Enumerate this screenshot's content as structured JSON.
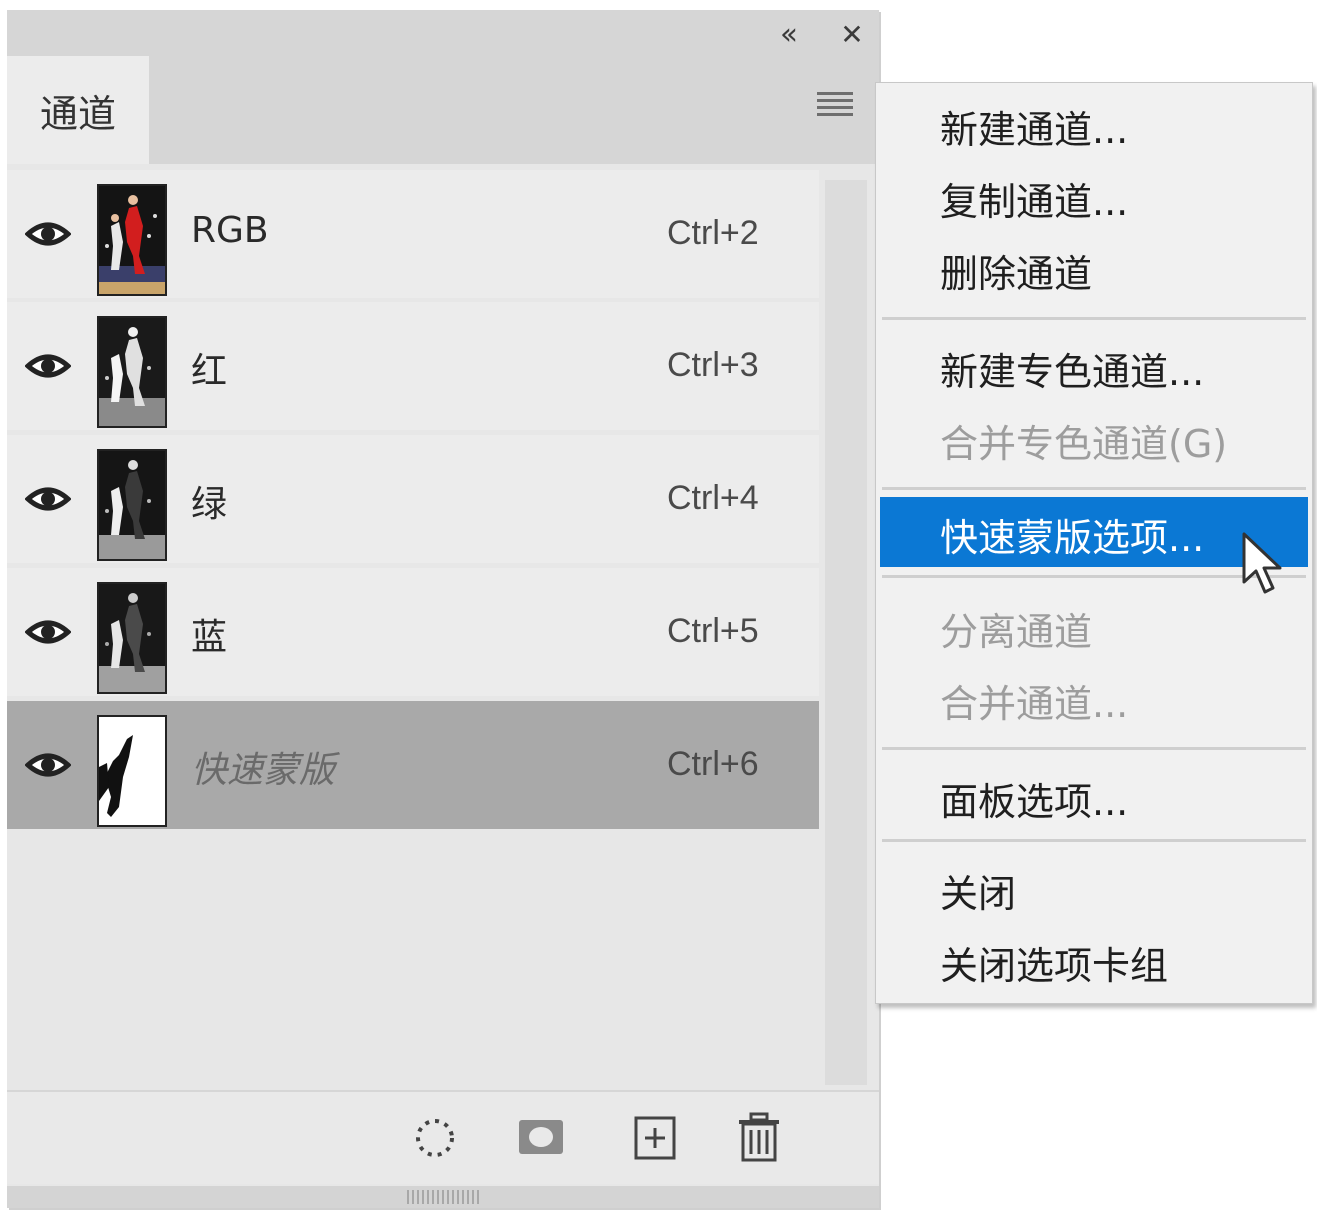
{
  "panel": {
    "tab_label": "通道",
    "collapse_glyph": "‹‹",
    "close_glyph": "✕"
  },
  "channels": [
    {
      "name": "RGB",
      "shortcut": "Ctrl+2",
      "visible": true,
      "selected": false,
      "thumbnail": "color-photo"
    },
    {
      "name": "红",
      "shortcut": "Ctrl+3",
      "visible": true,
      "selected": false,
      "thumbnail": "grayscale-photo"
    },
    {
      "name": "绿",
      "shortcut": "Ctrl+4",
      "visible": true,
      "selected": false,
      "thumbnail": "grayscale-photo"
    },
    {
      "name": "蓝",
      "shortcut": "Ctrl+5",
      "visible": true,
      "selected": false,
      "thumbnail": "grayscale-photo"
    },
    {
      "name": "快速蒙版",
      "shortcut": "Ctrl+6",
      "visible": true,
      "selected": true,
      "thumbnail": "mask-silhouette"
    }
  ],
  "bottom_bar": {
    "icons": [
      "load-selection-icon",
      "save-selection-icon",
      "new-channel-icon",
      "delete-icon"
    ]
  },
  "menu": {
    "groups": [
      [
        {
          "label": "新建通道...",
          "enabled": true
        },
        {
          "label": "复制通道...",
          "enabled": true
        },
        {
          "label": "删除通道",
          "enabled": true
        }
      ],
      [
        {
          "label": "新建专色通道...",
          "enabled": true
        },
        {
          "label": "合并专色通道(G)",
          "enabled": false
        }
      ],
      [
        {
          "label": "快速蒙版选项...",
          "enabled": true,
          "highlighted": true
        }
      ],
      [
        {
          "label": "分离通道",
          "enabled": false
        },
        {
          "label": "合并通道...",
          "enabled": false
        }
      ],
      [
        {
          "label": "面板选项...",
          "enabled": true
        }
      ],
      [
        {
          "label": "关闭",
          "enabled": true
        },
        {
          "label": "关闭选项卡组",
          "enabled": true
        }
      ]
    ],
    "highlight_color": "#0b78d4"
  }
}
